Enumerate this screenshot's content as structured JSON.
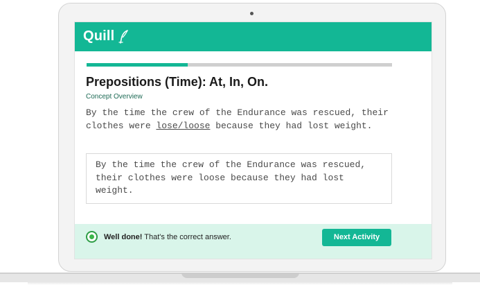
{
  "app": {
    "name": "Quill"
  },
  "activity": {
    "progress_fraction": 0.33,
    "title": "Prepositions (Time): At, In, On.",
    "concept_link": "Concept Overview",
    "prompt_before": "By the time the crew of the Endurance was rescued, their clothes were ",
    "prompt_choice": "lose/loose",
    "prompt_after": " because they had lost weight.",
    "answer": "By the time the crew of the Endurance was rescued, their clothes were loose because they had lost weight."
  },
  "feedback": {
    "strong": "Well done!",
    "message": " That's the correct answer.",
    "next_label": "Next Activity"
  },
  "colors": {
    "brand": "#13b795",
    "feedback_bg": "#d9f5ea",
    "check": "#3cb54a"
  }
}
